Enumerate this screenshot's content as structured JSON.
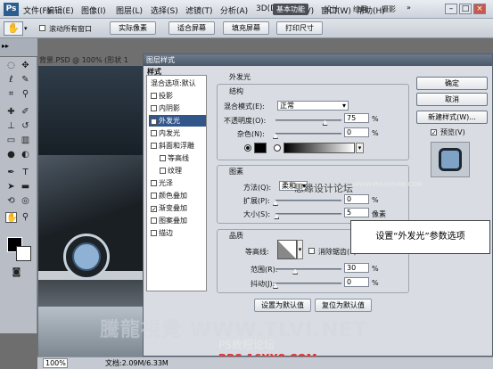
{
  "app": {
    "logo": "Ps",
    "menus": [
      "文件(F)",
      "编辑(E)",
      "图像(I)",
      "图层(L)",
      "选择(S)",
      "滤镜(T)",
      "分析(A)",
      "3D(D)",
      "视图(V)",
      "窗口(W)",
      "帮助(H)"
    ],
    "workspaces": [
      "基本功能",
      "设计",
      "绘画",
      "摄影"
    ],
    "window_controls": [
      "–",
      "□",
      "×"
    ]
  },
  "options_bar": {
    "scroll_all": "滚动所有窗口",
    "buttons": [
      "实际像素",
      "适合屏幕",
      "填充屏幕",
      "打印尺寸"
    ]
  },
  "document": {
    "tab": "背景.PSD @ 100% (形状 1"
  },
  "status": {
    "zoom": "100%",
    "doc_size": "文档:2.09M/6.33M"
  },
  "dialog": {
    "title": "图层样式",
    "list_header": "样式",
    "list_items": [
      {
        "label": "混合选项:默认",
        "cb": false,
        "checked": false
      },
      {
        "label": "投影",
        "cb": true,
        "checked": false
      },
      {
        "label": "内阴影",
        "cb": true,
        "checked": false
      },
      {
        "label": "外发光",
        "cb": true,
        "checked": true,
        "selected": true
      },
      {
        "label": "内发光",
        "cb": true,
        "checked": false
      },
      {
        "label": "斜面和浮雕",
        "cb": true,
        "checked": false
      },
      {
        "label": "等高线",
        "cb": true,
        "checked": false,
        "indent": true
      },
      {
        "label": "纹理",
        "cb": true,
        "checked": false,
        "indent": true
      },
      {
        "label": "光泽",
        "cb": true,
        "checked": false
      },
      {
        "label": "颜色叠加",
        "cb": true,
        "checked": false
      },
      {
        "label": "渐变叠加",
        "cb": true,
        "checked": true
      },
      {
        "label": "图案叠加",
        "cb": true,
        "checked": false
      },
      {
        "label": "描边",
        "cb": true,
        "checked": false
      }
    ],
    "buttons": {
      "ok": "确定",
      "cancel": "取消",
      "new_style": "新建样式(W)...",
      "preview": "预览(V)"
    },
    "panel_title": "外发光",
    "structure": {
      "title": "结构",
      "blend_mode_label": "混合模式(E):",
      "blend_mode": "正常",
      "opacity_label": "不透明度(O):",
      "opacity": "75",
      "noise_label": "杂色(N):",
      "noise": "0",
      "pct": "%",
      "opacity_level": 0.75,
      "noise_level": 0.0
    },
    "elements": {
      "title": "图素",
      "method_label": "方法(Q):",
      "method": "柔和",
      "spread_label": "扩展(P):",
      "spread": "0",
      "size_label": "大小(S):",
      "size": "5",
      "px": "像素",
      "spread_level": 0.0,
      "size_level": 0.02
    },
    "quality": {
      "title": "品质",
      "contour_label": "等高线:",
      "antialias_label": "消除锯齿(L)",
      "range_label": "范围(R):",
      "range": "30",
      "jitter_label": "抖动(J):",
      "jitter": "0",
      "range_level": 0.3,
      "jitter_level": 0.0
    },
    "footer": {
      "set_default": "设置为默认值",
      "reset_default": "复位为默认值"
    }
  },
  "callout": "设置“外发光”参数选项",
  "watermarks": {
    "site_cn": "思缘设计论坛",
    "site_url": "WWW.MISSVUAN.COM",
    "big": "騰龍視覺 WWW.TLVI.NET",
    "ps_forum": "PS教程论坛",
    "bbs": "BBS.16XX8.COM"
  },
  "colors": {
    "accent": "#32568a",
    "title_bar": "#4b596a",
    "dialog_bg": "#d9dde3"
  }
}
